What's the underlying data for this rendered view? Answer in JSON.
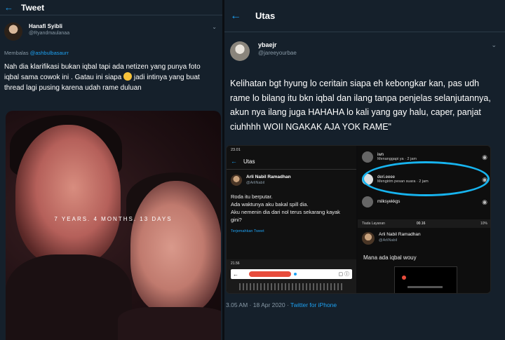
{
  "left": {
    "header_title": "Tweet",
    "user": {
      "name": "Hanafi Syibli",
      "handle": "@Ryandmaulanaa"
    },
    "reply_prefix": "Membalas",
    "reply_mention": "@ashbulbasaurr",
    "text_part1": "Nah dia klarifikasi bukan iqbal tapi ada netizen yang punya foto iqbal sama cowok ini . Gatau ini siapa",
    "text_part2": " jadi intinya yang buat thread lagi pusing karena udah rame duluan",
    "photo_overlay": "7 YEARS. 4 MONTHS. 13 DAYS"
  },
  "right": {
    "header_title": "Utas",
    "user": {
      "name": "ybaejr",
      "handle": "@jareeyourbae"
    },
    "text": "Kelihatan bgt hyung lo ceritain siapa eh kebongkar kan, pas udh rame lo bilang itu bkn iqbal dan ilang tanpa penjelas selanjutannya, akun nya ilang juga HAHAHA lo kali yang gay halu, caper, panjat ciuhhhh WOII NGAKAK AJA YOK RAME\"",
    "embed": {
      "left_shot": {
        "status_time": "23.01",
        "status_right": "",
        "header": "Utas",
        "user_name": "Arli Nabil Ramadhan",
        "user_handle": "@ArliNabil",
        "tweet_text": "Roda itu berputar.\nAda waktunya aku bakal spill dia.\nAku nemenin dia dari nol terus sekarang kayak gini?",
        "translate": "Terjemahkan Tweet",
        "bottom_time": "21.56"
      },
      "right_shot": {
        "items": [
          {
            "name": "iwn",
            "sub": "Menanggapi ya · 2 jam"
          },
          {
            "name": "deri.eeee",
            "sub": "Mengirim pesan suara · 2 jam"
          },
          {
            "name": "milksyekkgs",
            "sub": ""
          }
        ],
        "bar_left": "Tiada Layanan",
        "bar_mid": "00.16",
        "bar_right": "10%",
        "user_name": "Arli Nabil Ramadhan",
        "user_handle": "@ArliNabil",
        "message": "Mana ada iqbal wouy"
      }
    },
    "timestamp": "3.05 AM · 18 Apr 2020 · ",
    "source": "Twitter for iPhone"
  },
  "colors": {
    "background": "#15202b",
    "accent": "#1da1f2",
    "muted": "#8899a6",
    "highlight_circle": "#17b4ef"
  }
}
